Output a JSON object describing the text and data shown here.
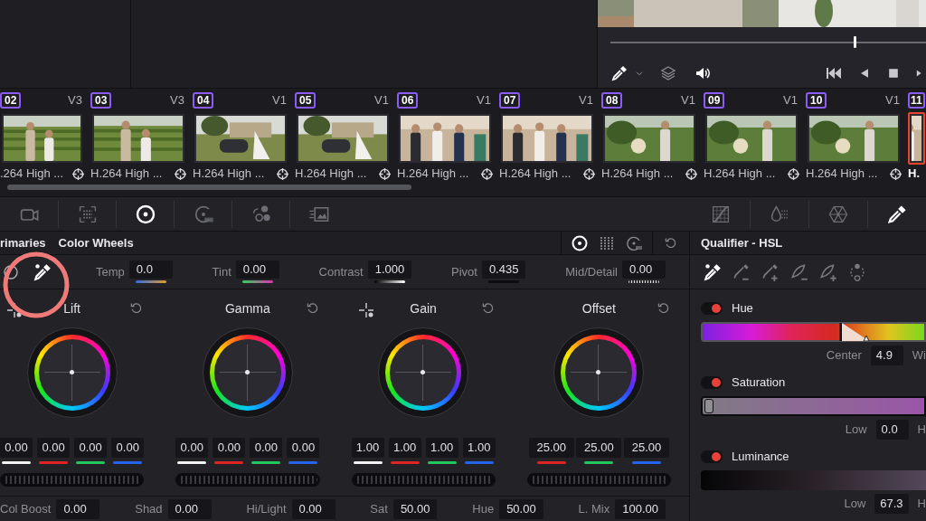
{
  "viewer": {
    "playhead": {
      "level": 0.77
    }
  },
  "clips": [
    {
      "number": "02",
      "track": "V3",
      "codec": ".264 High ...",
      "selected": false
    },
    {
      "number": "03",
      "track": "V3",
      "codec": "H.264 High ...",
      "selected": false
    },
    {
      "number": "04",
      "track": "V1",
      "codec": "H.264 High ...",
      "selected": false
    },
    {
      "number": "05",
      "track": "V1",
      "codec": "H.264 High ...",
      "selected": false
    },
    {
      "number": "06",
      "track": "V1",
      "codec": "H.264 High ...",
      "selected": false
    },
    {
      "number": "07",
      "track": "V1",
      "codec": "H.264 High ...",
      "selected": false
    },
    {
      "number": "08",
      "track": "V1",
      "codec": "H.264 High ...",
      "selected": false
    },
    {
      "number": "09",
      "track": "V1",
      "codec": "H.264 High ...",
      "selected": false
    },
    {
      "number": "10",
      "track": "V1",
      "codec": "H.264 High ...",
      "selected": false
    },
    {
      "number": "11",
      "codec": "H.",
      "selected": true
    }
  ],
  "palette_left": [
    {
      "kind": "raw",
      "selected": false
    },
    {
      "kind": "matte",
      "selected": false
    },
    {
      "kind": "wheels",
      "selected": true
    },
    {
      "kind": "hdr",
      "selected": false
    },
    {
      "kind": "mixer",
      "selected": false
    },
    {
      "kind": "motion",
      "selected": false
    }
  ],
  "palette_right": [
    {
      "kind": "curves",
      "selected": false
    },
    {
      "kind": "warper",
      "selected": false
    },
    {
      "kind": "mesh",
      "selected": false
    },
    {
      "kind": "qualifier",
      "selected": true
    }
  ],
  "primaries": {
    "title": "rimaries",
    "subtitle": "Color Wheels",
    "modes": [
      {
        "kind": "wheels",
        "selected": true
      },
      {
        "kind": "bars",
        "selected": false
      },
      {
        "kind": "log",
        "selected": false
      }
    ],
    "adjustments": [
      {
        "label": "Temp",
        "value": "0.0",
        "kind": "temp"
      },
      {
        "label": "Tint",
        "value": "0.00",
        "kind": "tint"
      },
      {
        "label": "Contrast",
        "value": "1.000",
        "kind": "contrast"
      },
      {
        "label": "Pivot",
        "value": "0.435",
        "kind": "pivot"
      },
      {
        "label": "Mid/Detail",
        "value": "0.00",
        "kind": "detail"
      }
    ],
    "wheels": [
      {
        "name": "Lift",
        "picker": true,
        "values": [
          {
            "kind": "y",
            "value": "0.00"
          },
          {
            "kind": "r",
            "value": "0.00"
          },
          {
            "kind": "g",
            "value": "0.00"
          },
          {
            "kind": "b",
            "value": "0.00"
          }
        ]
      },
      {
        "name": "Gamma",
        "picker": false,
        "values": [
          {
            "kind": "y",
            "value": "0.00"
          },
          {
            "kind": "r",
            "value": "0.00"
          },
          {
            "kind": "g",
            "value": "0.00"
          },
          {
            "kind": "b",
            "value": "0.00"
          }
        ]
      },
      {
        "name": "Gain",
        "picker": true,
        "values": [
          {
            "kind": "y",
            "value": "1.00"
          },
          {
            "kind": "r",
            "value": "1.00"
          },
          {
            "kind": "g",
            "value": "1.00"
          },
          {
            "kind": "b",
            "value": "1.00"
          }
        ]
      },
      {
        "name": "Offset",
        "picker": false,
        "values": [
          {
            "kind": "r",
            "value": "25.00"
          },
          {
            "kind": "g",
            "value": "25.00"
          },
          {
            "kind": "b",
            "value": "25.00"
          }
        ]
      }
    ],
    "bottom": [
      {
        "label": "Col Boost",
        "value": "0.00"
      },
      {
        "label": "Shad",
        "value": "0.00"
      },
      {
        "label": "Hi/Light",
        "value": "0.00"
      },
      {
        "label": "Sat",
        "value": "50.00"
      },
      {
        "label": "Hue",
        "value": "50.00"
      },
      {
        "label": "L. Mix",
        "value": "100.00"
      }
    ]
  },
  "qualifier": {
    "title": "Qualifier - HSL",
    "tools": [
      {
        "kind": "picker",
        "selected": true
      },
      {
        "kind": "picker-minus",
        "selected": false
      },
      {
        "kind": "picker-plus",
        "selected": false
      },
      {
        "kind": "feather-minus",
        "selected": false
      },
      {
        "kind": "feather-plus",
        "selected": false
      },
      {
        "kind": "invert",
        "selected": false
      }
    ],
    "channels": [
      {
        "name": "Hue",
        "on": true,
        "kind": "hue",
        "fields": [
          {
            "label": "Center",
            "value": "4.9"
          },
          {
            "label": "Wi"
          }
        ]
      },
      {
        "name": "Saturation",
        "on": true,
        "kind": "sat",
        "fields": [
          {
            "label": "Low",
            "value": "0.0"
          },
          {
            "label": "H"
          }
        ]
      },
      {
        "name": "Luminance",
        "on": true,
        "kind": "lum",
        "fields": [
          {
            "label": "Low",
            "value": "67.3"
          },
          {
            "label": "H"
          }
        ]
      }
    ]
  }
}
